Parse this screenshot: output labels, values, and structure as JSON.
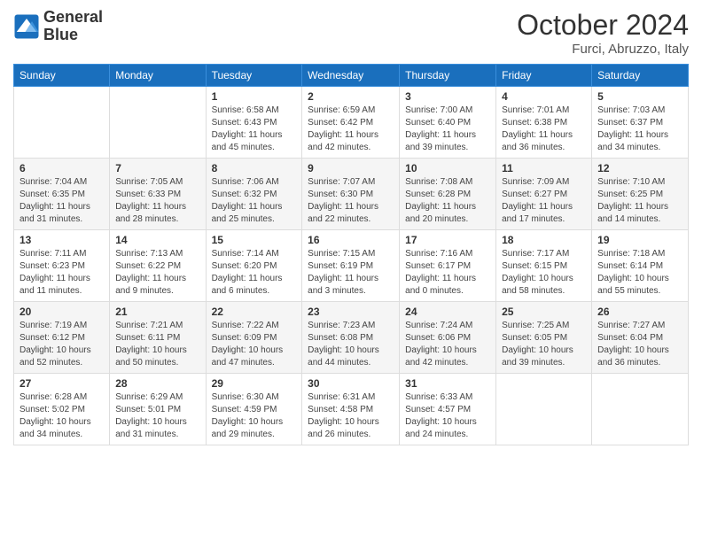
{
  "header": {
    "logo_line1": "General",
    "logo_line2": "Blue",
    "month_title": "October 2024",
    "location": "Furci, Abruzzo, Italy"
  },
  "days_of_week": [
    "Sunday",
    "Monday",
    "Tuesday",
    "Wednesday",
    "Thursday",
    "Friday",
    "Saturday"
  ],
  "weeks": [
    [
      {
        "day": "",
        "info": ""
      },
      {
        "day": "",
        "info": ""
      },
      {
        "day": "1",
        "info": "Sunrise: 6:58 AM\nSunset: 6:43 PM\nDaylight: 11 hours and 45 minutes."
      },
      {
        "day": "2",
        "info": "Sunrise: 6:59 AM\nSunset: 6:42 PM\nDaylight: 11 hours and 42 minutes."
      },
      {
        "day": "3",
        "info": "Sunrise: 7:00 AM\nSunset: 6:40 PM\nDaylight: 11 hours and 39 minutes."
      },
      {
        "day": "4",
        "info": "Sunrise: 7:01 AM\nSunset: 6:38 PM\nDaylight: 11 hours and 36 minutes."
      },
      {
        "day": "5",
        "info": "Sunrise: 7:03 AM\nSunset: 6:37 PM\nDaylight: 11 hours and 34 minutes."
      }
    ],
    [
      {
        "day": "6",
        "info": "Sunrise: 7:04 AM\nSunset: 6:35 PM\nDaylight: 11 hours and 31 minutes."
      },
      {
        "day": "7",
        "info": "Sunrise: 7:05 AM\nSunset: 6:33 PM\nDaylight: 11 hours and 28 minutes."
      },
      {
        "day": "8",
        "info": "Sunrise: 7:06 AM\nSunset: 6:32 PM\nDaylight: 11 hours and 25 minutes."
      },
      {
        "day": "9",
        "info": "Sunrise: 7:07 AM\nSunset: 6:30 PM\nDaylight: 11 hours and 22 minutes."
      },
      {
        "day": "10",
        "info": "Sunrise: 7:08 AM\nSunset: 6:28 PM\nDaylight: 11 hours and 20 minutes."
      },
      {
        "day": "11",
        "info": "Sunrise: 7:09 AM\nSunset: 6:27 PM\nDaylight: 11 hours and 17 minutes."
      },
      {
        "day": "12",
        "info": "Sunrise: 7:10 AM\nSunset: 6:25 PM\nDaylight: 11 hours and 14 minutes."
      }
    ],
    [
      {
        "day": "13",
        "info": "Sunrise: 7:11 AM\nSunset: 6:23 PM\nDaylight: 11 hours and 11 minutes."
      },
      {
        "day": "14",
        "info": "Sunrise: 7:13 AM\nSunset: 6:22 PM\nDaylight: 11 hours and 9 minutes."
      },
      {
        "day": "15",
        "info": "Sunrise: 7:14 AM\nSunset: 6:20 PM\nDaylight: 11 hours and 6 minutes."
      },
      {
        "day": "16",
        "info": "Sunrise: 7:15 AM\nSunset: 6:19 PM\nDaylight: 11 hours and 3 minutes."
      },
      {
        "day": "17",
        "info": "Sunrise: 7:16 AM\nSunset: 6:17 PM\nDaylight: 11 hours and 0 minutes."
      },
      {
        "day": "18",
        "info": "Sunrise: 7:17 AM\nSunset: 6:15 PM\nDaylight: 10 hours and 58 minutes."
      },
      {
        "day": "19",
        "info": "Sunrise: 7:18 AM\nSunset: 6:14 PM\nDaylight: 10 hours and 55 minutes."
      }
    ],
    [
      {
        "day": "20",
        "info": "Sunrise: 7:19 AM\nSunset: 6:12 PM\nDaylight: 10 hours and 52 minutes."
      },
      {
        "day": "21",
        "info": "Sunrise: 7:21 AM\nSunset: 6:11 PM\nDaylight: 10 hours and 50 minutes."
      },
      {
        "day": "22",
        "info": "Sunrise: 7:22 AM\nSunset: 6:09 PM\nDaylight: 10 hours and 47 minutes."
      },
      {
        "day": "23",
        "info": "Sunrise: 7:23 AM\nSunset: 6:08 PM\nDaylight: 10 hours and 44 minutes."
      },
      {
        "day": "24",
        "info": "Sunrise: 7:24 AM\nSunset: 6:06 PM\nDaylight: 10 hours and 42 minutes."
      },
      {
        "day": "25",
        "info": "Sunrise: 7:25 AM\nSunset: 6:05 PM\nDaylight: 10 hours and 39 minutes."
      },
      {
        "day": "26",
        "info": "Sunrise: 7:27 AM\nSunset: 6:04 PM\nDaylight: 10 hours and 36 minutes."
      }
    ],
    [
      {
        "day": "27",
        "info": "Sunrise: 6:28 AM\nSunset: 5:02 PM\nDaylight: 10 hours and 34 minutes."
      },
      {
        "day": "28",
        "info": "Sunrise: 6:29 AM\nSunset: 5:01 PM\nDaylight: 10 hours and 31 minutes."
      },
      {
        "day": "29",
        "info": "Sunrise: 6:30 AM\nSunset: 4:59 PM\nDaylight: 10 hours and 29 minutes."
      },
      {
        "day": "30",
        "info": "Sunrise: 6:31 AM\nSunset: 4:58 PM\nDaylight: 10 hours and 26 minutes."
      },
      {
        "day": "31",
        "info": "Sunrise: 6:33 AM\nSunset: 4:57 PM\nDaylight: 10 hours and 24 minutes."
      },
      {
        "day": "",
        "info": ""
      },
      {
        "day": "",
        "info": ""
      }
    ]
  ]
}
